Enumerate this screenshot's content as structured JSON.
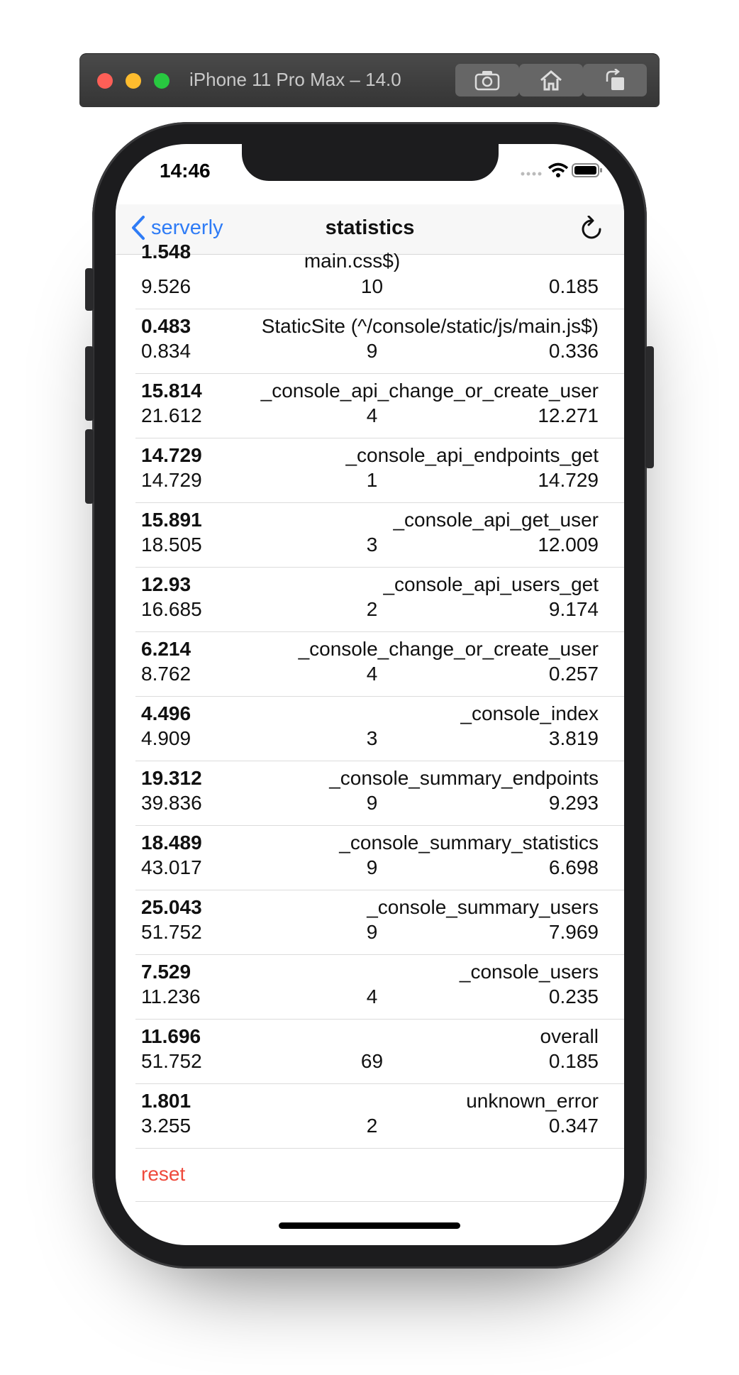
{
  "simulator": {
    "title": "iPhone 11 Pro Max – 14.0"
  },
  "status_bar": {
    "time": "14:46"
  },
  "nav": {
    "back_label": "serverly",
    "title": "statistics"
  },
  "rows": [
    {
      "avg": "1.548",
      "name": "main.css$)",
      "max": "9.526",
      "count": "10",
      "min": "0.185"
    },
    {
      "avg": "0.483",
      "name": "StaticSite (^/console/static/js/main.js$)",
      "max": "0.834",
      "count": "9",
      "min": "0.336"
    },
    {
      "avg": "15.814",
      "name": "_console_api_change_or_create_user",
      "max": "21.612",
      "count": "4",
      "min": "12.271"
    },
    {
      "avg": "14.729",
      "name": "_console_api_endpoints_get",
      "max": "14.729",
      "count": "1",
      "min": "14.729"
    },
    {
      "avg": "15.891",
      "name": "_console_api_get_user",
      "max": "18.505",
      "count": "3",
      "min": "12.009"
    },
    {
      "avg": "12.93",
      "name": "_console_api_users_get",
      "max": "16.685",
      "count": "2",
      "min": "9.174"
    },
    {
      "avg": "6.214",
      "name": "_console_change_or_create_user",
      "max": "8.762",
      "count": "4",
      "min": "0.257"
    },
    {
      "avg": "4.496",
      "name": "_console_index",
      "max": "4.909",
      "count": "3",
      "min": "3.819"
    },
    {
      "avg": "19.312",
      "name": "_console_summary_endpoints",
      "max": "39.836",
      "count": "9",
      "min": "9.293"
    },
    {
      "avg": "18.489",
      "name": "_console_summary_statistics",
      "max": "43.017",
      "count": "9",
      "min": "6.698"
    },
    {
      "avg": "25.043",
      "name": "_console_summary_users",
      "max": "51.752",
      "count": "9",
      "min": "7.969"
    },
    {
      "avg": "7.529",
      "name": "_console_users",
      "max": "11.236",
      "count": "4",
      "min": "0.235"
    },
    {
      "avg": "11.696",
      "name": "overall",
      "max": "51.752",
      "count": "69",
      "min": "0.185"
    },
    {
      "avg": "1.801",
      "name": "unknown_error",
      "max": "3.255",
      "count": "2",
      "min": "0.347"
    }
  ],
  "reset_label": "reset",
  "colors": {
    "accent": "#2f7cf6",
    "destructive": "#ef4a3c"
  }
}
